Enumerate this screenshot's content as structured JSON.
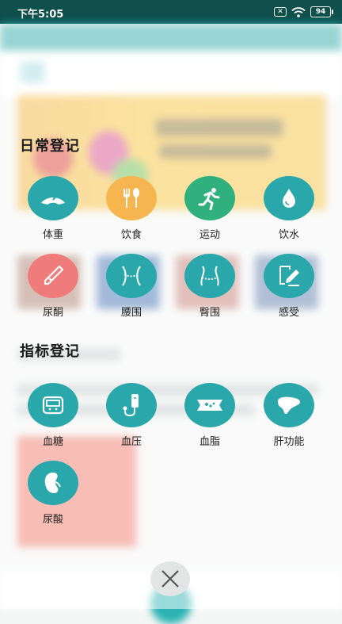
{
  "status_bar": {
    "time": "下午5:05",
    "battery": "94"
  },
  "sections": {
    "daily": {
      "title": "日常登记",
      "items": [
        {
          "label": "体重",
          "icon": "scale-icon",
          "color": "#2aa7ab"
        },
        {
          "label": "饮食",
          "icon": "fork-spoon-icon",
          "color": "#f6b54f"
        },
        {
          "label": "运动",
          "icon": "running-icon",
          "color": "#2fb07d"
        },
        {
          "label": "饮水",
          "icon": "water-drop-icon",
          "color": "#2aa7ab"
        },
        {
          "label": "尿酮",
          "icon": "test-strip-icon",
          "color": "#ef7b7b"
        },
        {
          "label": "腰围",
          "icon": "waist-icon",
          "color": "#2aa7ab"
        },
        {
          "label": "臀围",
          "icon": "hip-icon",
          "color": "#2aa7ab"
        },
        {
          "label": "感受",
          "icon": "note-pen-icon",
          "color": "#2aa7ab"
        }
      ]
    },
    "indicators": {
      "title": "指标登记",
      "items": [
        {
          "label": "血糖",
          "icon": "glucose-meter-icon",
          "color": "#2aa7ab"
        },
        {
          "label": "血压",
          "icon": "blood-pressure-icon",
          "color": "#2aa7ab"
        },
        {
          "label": "血脂",
          "icon": "lipid-vessel-icon",
          "color": "#2aa7ab"
        },
        {
          "label": "肝功能",
          "icon": "liver-icon",
          "color": "#2aa7ab"
        },
        {
          "label": "尿酸",
          "icon": "kidney-icon",
          "color": "#2aa7ab"
        }
      ]
    }
  },
  "close_icon": "close-icon"
}
